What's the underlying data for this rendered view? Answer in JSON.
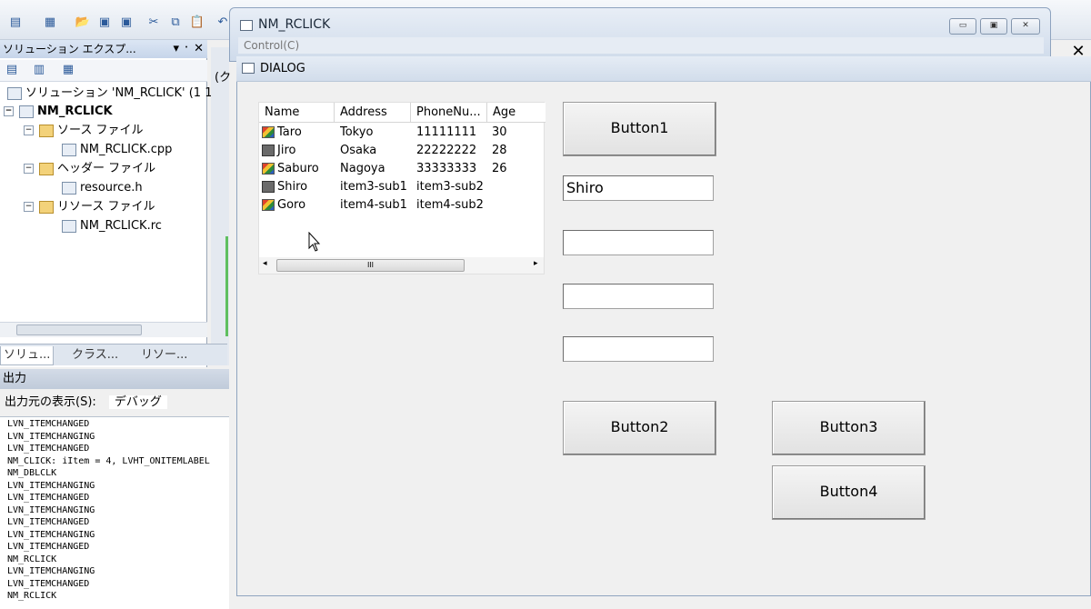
{
  "ide": {
    "solution_panel": {
      "title": "ソリューション エクスプ...",
      "pin": "▾ ᛫ ✕",
      "tree": {
        "solution": "ソリューション 'NM_RCLICK' (1 1",
        "project": "NM_RCLICK",
        "source_folder": "ソース ファイル",
        "source_file": "NM_RCLICK.cpp",
        "header_folder": "ヘッダー ファイル",
        "header_file": "resource.h",
        "resource_folder": "リソース ファイル",
        "resource_file": "NM_RCLICK.rc"
      },
      "tabs": [
        "ソリュ...",
        "クラス...",
        "リソー..."
      ]
    },
    "output": {
      "title": "出力",
      "source_label": "出力元の表示(S):",
      "source_value": "デバッグ",
      "lines": [
        "LVN_ITEMCHANGED",
        "LVN_ITEMCHANGING",
        "LVN_ITEMCHANGED",
        "NM_CLICK: iItem = 4, LVHT_ONITEMLABEL",
        "NM_DBLCLK",
        "LVN_ITEMCHANGING",
        "LVN_ITEMCHANGED",
        "LVN_ITEMCHANGING",
        "LVN_ITEMCHANGED",
        "LVN_ITEMCHANGING",
        "LVN_ITEMCHANGED",
        "NM_RCLICK",
        "LVN_ITEMCHANGING",
        "LVN_ITEMCHANGED",
        "NM_RCLICK"
      ]
    },
    "partial_text": "(ク"
  },
  "main_window": {
    "title": "NM_RCLICK",
    "menu": "Control(C)",
    "min": "▭",
    "max": "▣",
    "close": "✕"
  },
  "dialog": {
    "title": "DIALOG",
    "close": "✕",
    "listview": {
      "columns": [
        "Name",
        "Address",
        "PhoneNu...",
        "Age"
      ],
      "rows": [
        {
          "icon": "pencil",
          "name": "Taro",
          "address": "Tokyo",
          "phone": "11111111",
          "age": "30"
        },
        {
          "icon": "pc",
          "name": "Jiro",
          "address": "Osaka",
          "phone": "22222222",
          "age": "28"
        },
        {
          "icon": "pencil",
          "name": "Saburo",
          "address": "Nagoya",
          "phone": "33333333",
          "age": "26"
        },
        {
          "icon": "pc",
          "name": "Shiro",
          "address": "item3-sub1",
          "phone": "item3-sub2",
          "age": ""
        },
        {
          "icon": "pencil",
          "name": "Goro",
          "address": "item4-sub1",
          "phone": "item4-sub2",
          "age": ""
        }
      ],
      "scroll_grip": "III"
    },
    "button1": "Button1",
    "button2": "Button2",
    "button3": "Button3",
    "button4": "Button4",
    "edit1": "Shiro",
    "edit2": "",
    "edit3": "",
    "edit4": ""
  }
}
